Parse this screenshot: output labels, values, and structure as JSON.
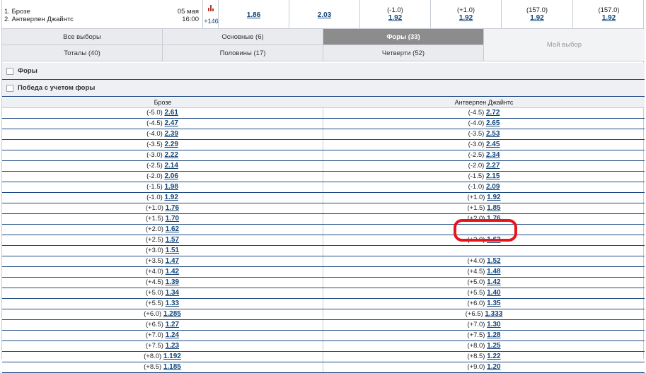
{
  "match": {
    "team1": "1. Брозе",
    "team2": "2. Антверпен Джайнтс",
    "date": "05 мая",
    "time": "16:00",
    "more_markets": "+146",
    "stats_icon": "bar-chart-icon",
    "odds": [
      {
        "top": "",
        "bottom": "1.86"
      },
      {
        "top": "",
        "bottom": "2.03"
      },
      {
        "top": "(-1.0)",
        "bottom": "1.92"
      },
      {
        "top": "(+1.0)",
        "bottom": "1.92"
      },
      {
        "top": "(157.0)",
        "bottom": "1.92"
      },
      {
        "top": "(157.0)",
        "bottom": "1.92"
      }
    ]
  },
  "tabs": {
    "all": "Все выборы",
    "main": "Основные (6)",
    "handicaps": "Форы (33)",
    "totals": "Тоталы (40)",
    "halves": "Половины (17)",
    "quarters": "Четверти (52)",
    "my_choice": "Мой выбор"
  },
  "sections": {
    "handicaps": "Форы",
    "win_handicap": "Победа с учетом форы"
  },
  "table": {
    "col1": "Брозе",
    "col2": "Антверпен Джайнтс",
    "rows": [
      {
        "h1": "(-5.0)",
        "o1": "2.61",
        "h2": "(-4.5)",
        "o2": "2.72"
      },
      {
        "h1": "(-4.5)",
        "o1": "2.47",
        "h2": "(-4.0)",
        "o2": "2.65"
      },
      {
        "h1": "(-4.0)",
        "o1": "2.39",
        "h2": "(-3.5)",
        "o2": "2.53"
      },
      {
        "h1": "(-3.5)",
        "o1": "2.29",
        "h2": "(-3.0)",
        "o2": "2.45"
      },
      {
        "h1": "(-3.0)",
        "o1": "2.22",
        "h2": "(-2.5)",
        "o2": "2.34"
      },
      {
        "h1": "(-2.5)",
        "o1": "2.14",
        "h2": "(-2.0)",
        "o2": "2.27"
      },
      {
        "h1": "(-2.0)",
        "o1": "2.06",
        "h2": "(-1.5)",
        "o2": "2.15"
      },
      {
        "h1": "(-1.5)",
        "o1": "1.98",
        "h2": "(-1.0)",
        "o2": "2.09"
      },
      {
        "h1": "(-1.0)",
        "o1": "1.92",
        "h2": "(+1.0)",
        "o2": "1.92"
      },
      {
        "h1": "(+1.0)",
        "o1": "1.76",
        "h2": "(+1.5)",
        "o2": "1.85"
      },
      {
        "h1": "(+1.5)",
        "o1": "1.70",
        "h2": "(+2.0)",
        "o2": "1.76"
      },
      {
        "h1": "(+2.0)",
        "o1": "1.62",
        "h2": "",
        "o2": ""
      },
      {
        "h1": "(+2.5)",
        "o1": "1.57",
        "h2": "(+3.0)",
        "o2": "1.63"
      },
      {
        "h1": "(+3.0)",
        "o1": "1.51",
        "h2": "",
        "o2": ""
      },
      {
        "h1": "(+3.5)",
        "o1": "1.47",
        "h2": "(+4.0)",
        "o2": "1.52"
      },
      {
        "h1": "(+4.0)",
        "o1": "1.42",
        "h2": "(+4.5)",
        "o2": "1.48"
      },
      {
        "h1": "(+4.5)",
        "o1": "1.39",
        "h2": "(+5.0)",
        "o2": "1.42"
      },
      {
        "h1": "(+5.0)",
        "o1": "1.34",
        "h2": "(+5.5)",
        "o2": "1.40"
      },
      {
        "h1": "(+5.5)",
        "o1": "1.33",
        "h2": "(+6.0)",
        "o2": "1.35"
      },
      {
        "h1": "(+6.0)",
        "o1": "1.285",
        "h2": "(+6.5)",
        "o2": "1.333"
      },
      {
        "h1": "(+6.5)",
        "o1": "1.27",
        "h2": "(+7.0)",
        "o2": "1.30"
      },
      {
        "h1": "(+7.0)",
        "o1": "1.24",
        "h2": "(+7.5)",
        "o2": "1.28"
      },
      {
        "h1": "(+7.5)",
        "o1": "1.23",
        "h2": "(+8.0)",
        "o2": "1.25"
      },
      {
        "h1": "(+8.0)",
        "o1": "1.192",
        "h2": "(+8.5)",
        "o2": "1.22"
      },
      {
        "h1": "(+8.5)",
        "o1": "1.185",
        "h2": "(+9.0)",
        "o2": "1.20"
      }
    ]
  },
  "highlight_color": "#e8141c"
}
